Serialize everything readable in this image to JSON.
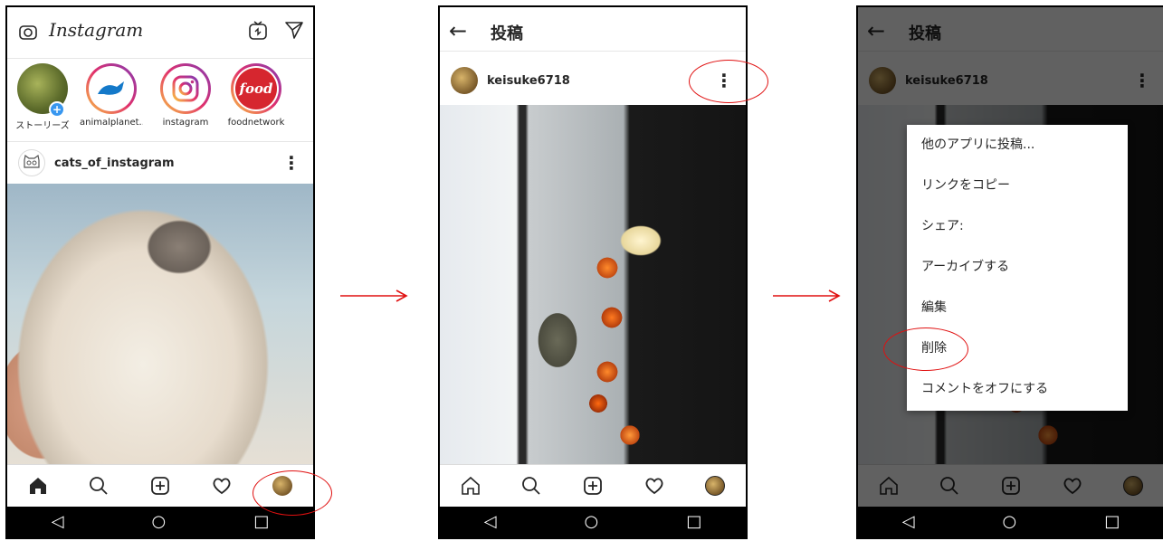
{
  "screen1": {
    "app_logo": "Instagram",
    "stories": [
      {
        "name": "ストーリーズ",
        "ring": "#dbdbdb",
        "pic": "#6b7d3a"
      },
      {
        "name": "animalplanet...",
        "ring": "#e1306c",
        "pic": "#ffffff"
      },
      {
        "name": "instagram",
        "ring": "#e1306c",
        "pic": "#ffffff"
      },
      {
        "name": "foodnetwork",
        "ring": "#e1306c",
        "pic": "#d6262f"
      }
    ],
    "post_user": "cats_of_instagram",
    "food_logo": "food"
  },
  "screen2": {
    "title": "投稿",
    "post_user": "keisuke6718"
  },
  "screen3": {
    "title": "投稿",
    "post_user": "keisuke6718",
    "menu_items": [
      "他のアプリに投稿...",
      "リンクをコピー",
      "シェア:",
      "アーカイブする",
      "編集",
      "削除",
      "コメントをオフにする"
    ]
  },
  "colors": {
    "annotation": "#e01010",
    "overlay": "rgba(0,0,0,0.62)"
  }
}
